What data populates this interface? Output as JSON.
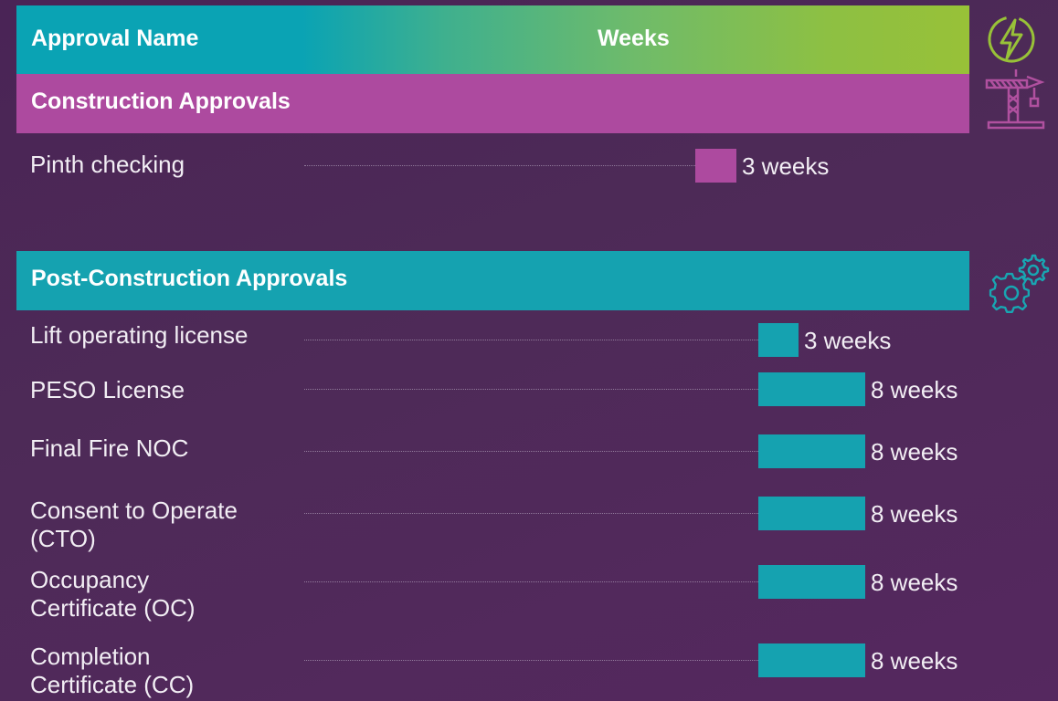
{
  "header": {
    "name_label": "Approval Name",
    "weeks_label": "Weeks"
  },
  "sections": [
    {
      "title": "Construction Approvals",
      "color": "#ad4a9f",
      "icon": "crane-icon"
    },
    {
      "title": "Post-Construction Approvals",
      "color": "#15a2b0",
      "icon": "gears-icon"
    }
  ],
  "header_icon": "lightning-icon",
  "rows": [
    {
      "label_lines": [
        "Pinth checking"
      ],
      "value_text": "3 weeks"
    },
    {
      "label_lines": [
        "Lift operating license"
      ],
      "value_text": "3 weeks"
    },
    {
      "label_lines": [
        "PESO License"
      ],
      "value_text": "8 weeks"
    },
    {
      "label_lines": [
        "Final Fire NOC"
      ],
      "value_text": "8 weeks"
    },
    {
      "label_lines": [
        "Consent to Operate",
        "(CTO)"
      ],
      "value_text": "8 weeks"
    },
    {
      "label_lines": [
        "Occupancy",
        "Certificate (OC)"
      ],
      "value_text": "8 weeks"
    },
    {
      "label_lines": [
        "Completion",
        "Certificate (CC)"
      ],
      "value_text": "8 weeks"
    }
  ],
  "chart_data": {
    "type": "bar",
    "orientation": "horizontal",
    "xlabel": "Weeks",
    "categories": [
      "Pinth checking",
      "Lift operating license",
      "PESO License",
      "Final Fire NOC",
      "Consent to Operate (CTO)",
      "Occupancy Certificate (OC)",
      "Completion Certificate (CC)"
    ],
    "groups": [
      {
        "name": "Construction Approvals",
        "categories": [
          "Pinth checking"
        ],
        "color": "#ad4a9f"
      },
      {
        "name": "Post-Construction Approvals",
        "categories": [
          "Lift operating license",
          "PESO License",
          "Final Fire NOC",
          "Consent to Operate (CTO)",
          "Occupancy Certificate (OC)",
          "Completion Certificate (CC)"
        ],
        "color": "#15a2b0"
      }
    ],
    "values": [
      3,
      3,
      8,
      8,
      8,
      8,
      8
    ]
  },
  "colors": {
    "construction": "#ad4a9f",
    "post": "#15a2b0",
    "accent_green": "#98c138"
  }
}
